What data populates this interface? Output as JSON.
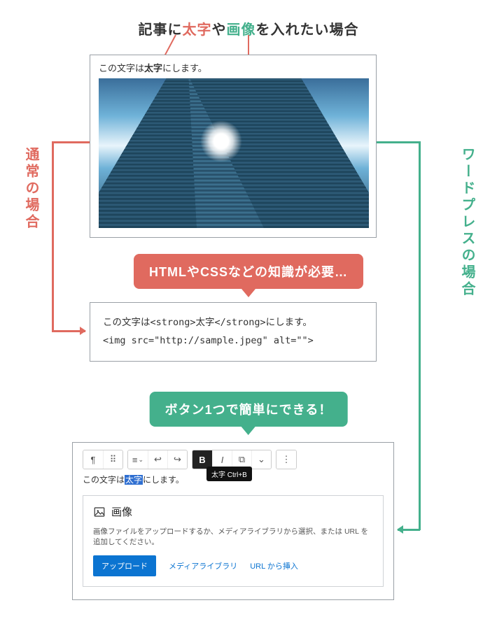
{
  "title": {
    "lead": "記事に",
    "bold_word": "太字",
    "mid": "や",
    "image_word": "画像",
    "tail": "を入れたい場合"
  },
  "side_labels": {
    "left": "通常の場合",
    "right": "ワードプレスの場合"
  },
  "preview": {
    "text_before": "この文字は",
    "text_bold": "太字",
    "text_after": "にします。"
  },
  "bubble_html_css": "HTMLやCSSなどの知識が必要…",
  "bubble_wordpress": "ボタン1つで簡単にできる！",
  "code": {
    "line1": "この文字は<strong>太字</strong>にします。",
    "line2": "<img src=\"http://sample.jpeg\" alt=\"\">"
  },
  "wp": {
    "toolbar": {
      "pilcrow": "¶",
      "dots": "⠿",
      "align": "≡",
      "indent_back": "↩",
      "indent_fwd": "↪",
      "bold": "B",
      "italic": "I",
      "link": "⧉",
      "more": "⌄",
      "kebab": "⋮"
    },
    "tooltip": "太字 Ctrl+B",
    "line_before": "この文字は",
    "line_highlight": "太字",
    "line_after": "にします。",
    "block": {
      "heading": "画像",
      "desc": "画像ファイルをアップロードするか、メディアライブラリから選択、または URL を追加してください。",
      "upload": "アップロード",
      "media_library": "メディアライブラリ",
      "url_insert": "URL から挿入"
    }
  }
}
